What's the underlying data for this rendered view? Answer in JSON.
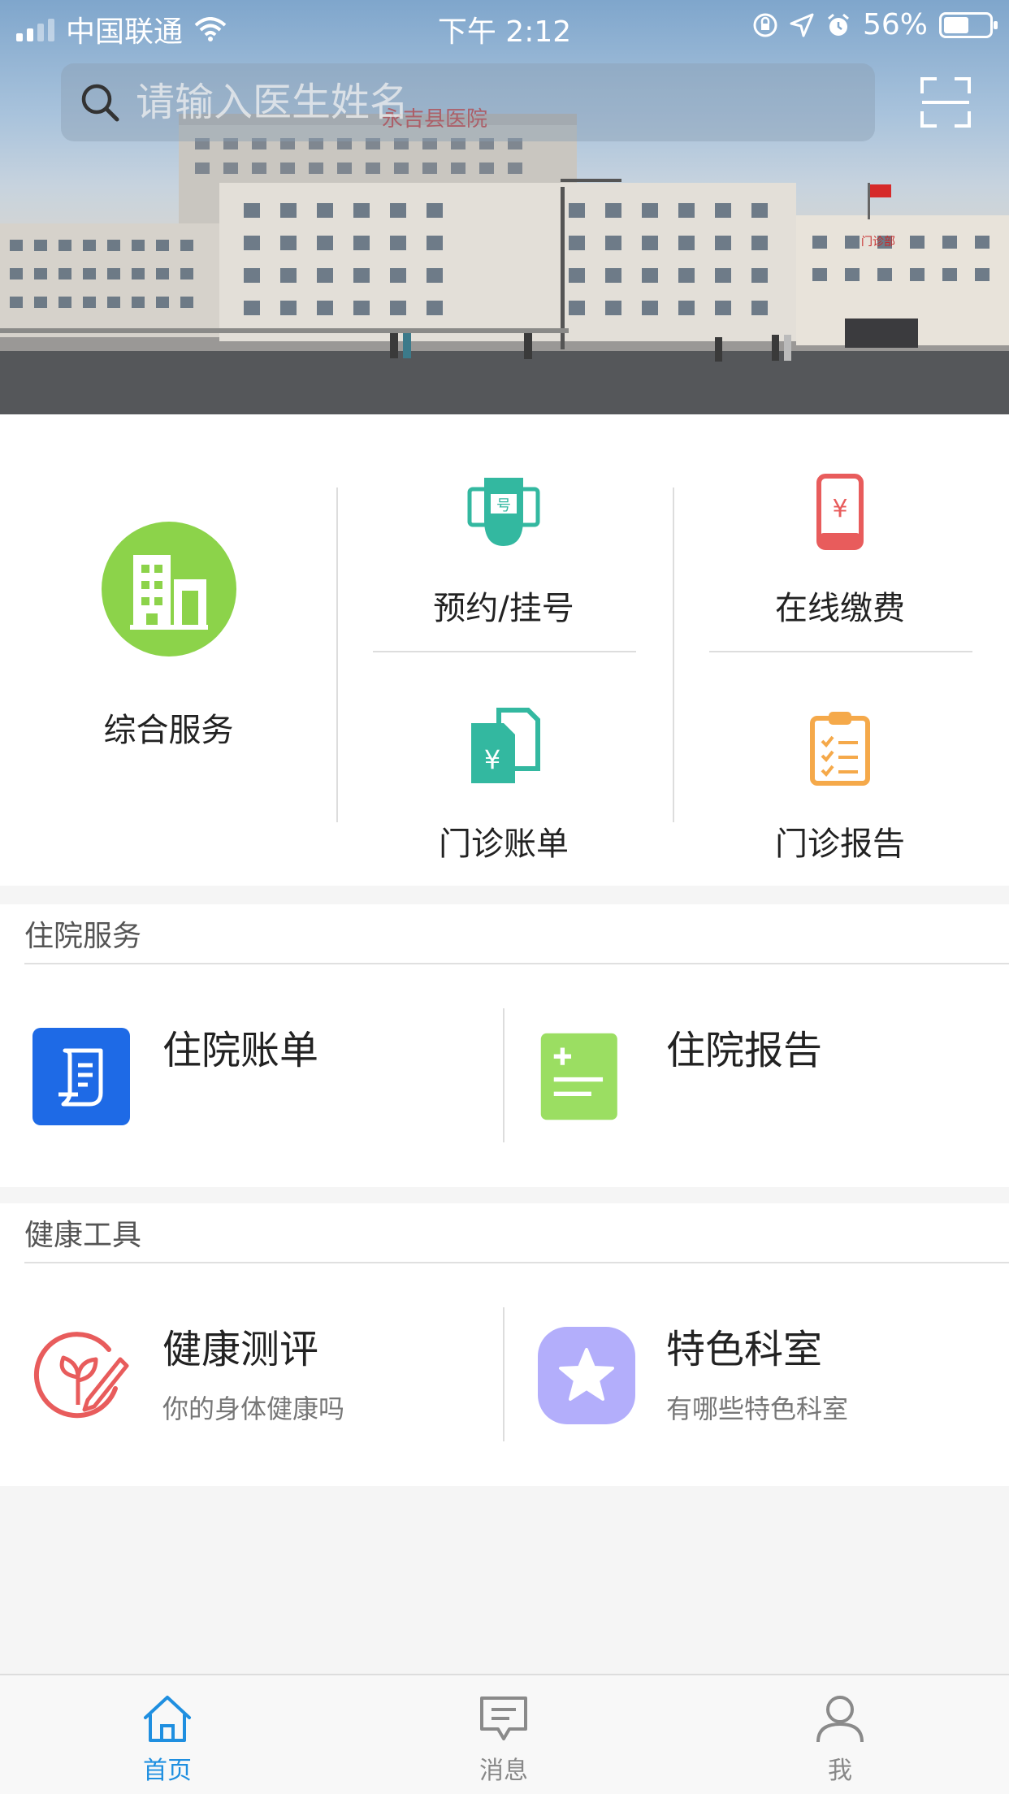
{
  "status_bar": {
    "carrier": "中国联通",
    "time": "下午 2:12",
    "battery": "56%"
  },
  "search": {
    "placeholder": "请输入医生姓名"
  },
  "hero": {
    "building_signs": [
      "永吉县医院",
      "门诊部"
    ]
  },
  "services": {
    "featured": {
      "label": "综合服务",
      "icon": "building-icon",
      "color": "#8cd34a"
    },
    "grid": [
      {
        "label": "预约/挂号",
        "icon": "registration-ticket-icon",
        "color": "#33b8a0"
      },
      {
        "label": "在线缴费",
        "icon": "phone-payment-icon",
        "color": "#e85c5c"
      },
      {
        "label": "门诊账单",
        "icon": "bill-documents-icon",
        "color": "#33b8a0"
      },
      {
        "label": "门诊报告",
        "icon": "clipboard-report-icon",
        "color": "#f5a94a"
      }
    ]
  },
  "inpatient": {
    "title": "住院服务",
    "items": [
      {
        "title": "住院账单",
        "icon": "scroll-bill-icon",
        "color": "#1e6ae6"
      },
      {
        "title": "住院报告",
        "icon": "report-list-icon",
        "color": "#9bde62"
      }
    ]
  },
  "health_tools": {
    "title": "健康工具",
    "items": [
      {
        "title": "健康测评",
        "subtitle": "你的身体健康吗",
        "icon": "sprout-pen-icon",
        "color": "#e85c5c"
      },
      {
        "title": "特色科室",
        "subtitle": "有哪些特色科室",
        "icon": "star-icon",
        "color": "#b3aefb"
      }
    ]
  },
  "tabbar": {
    "tabs": [
      {
        "label": "首页",
        "icon": "home-icon",
        "active": true
      },
      {
        "label": "消息",
        "icon": "message-icon",
        "active": false
      },
      {
        "label": "我",
        "icon": "user-icon",
        "active": false
      }
    ],
    "active_color": "#1f8fe0"
  }
}
